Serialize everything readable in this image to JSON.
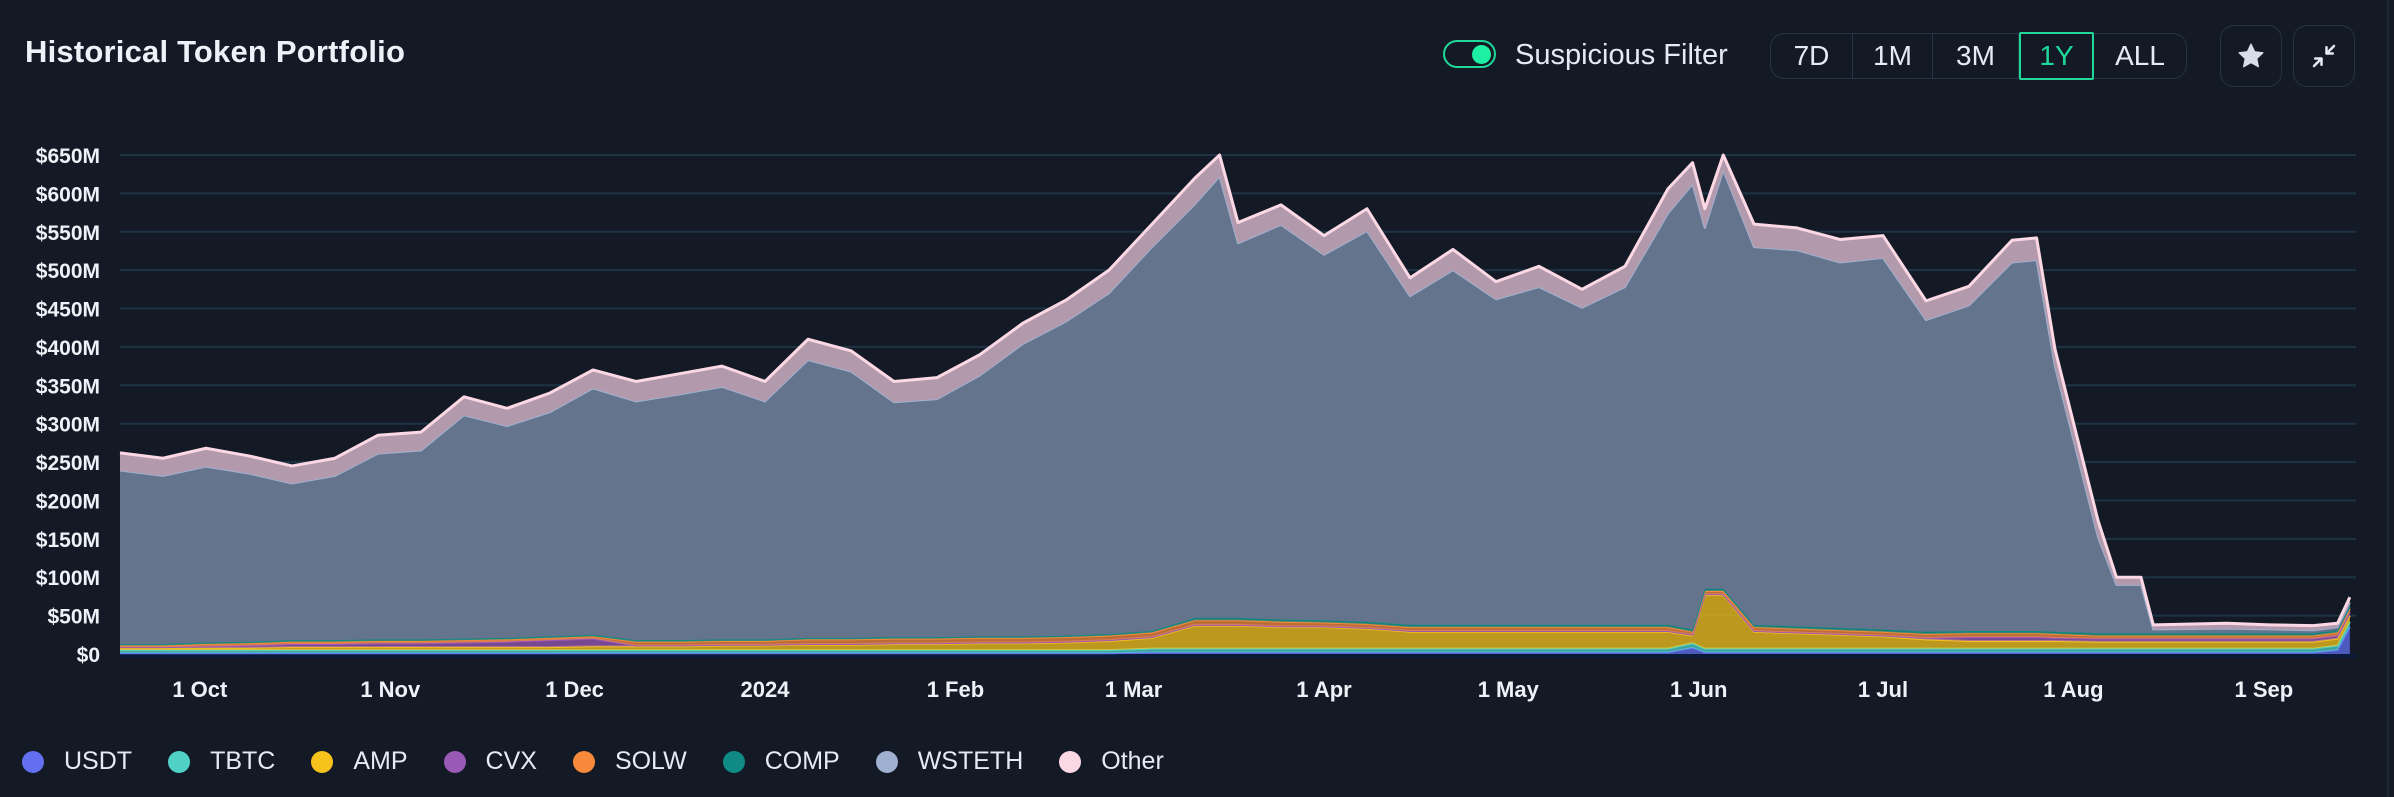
{
  "header": {
    "title": "Historical Token Portfolio",
    "suspicious_filter": {
      "label": "Suspicious Filter",
      "enabled": true
    },
    "ranges": [
      {
        "label": "7D",
        "active": false
      },
      {
        "label": "1M",
        "active": false
      },
      {
        "label": "3M",
        "active": false
      },
      {
        "label": "1Y",
        "active": true
      },
      {
        "label": "ALL",
        "active": false
      }
    ],
    "favorite_icon": "star-icon",
    "collapse_icon": "collapse-arrows-icon"
  },
  "colors": {
    "background": "#131a25",
    "accent": "#1fd99a",
    "gridline": "#1e3344"
  },
  "chart_data": {
    "type": "area",
    "stacked": true,
    "title": "Historical Token Portfolio",
    "xlabel": "",
    "ylabel": "",
    "ylim": [
      0,
      650
    ],
    "y_unit": "$M",
    "grid": true,
    "legend_position": "bottom-left",
    "yticks": [
      "$0",
      "$50M",
      "$100M",
      "$150M",
      "$200M",
      "$250M",
      "$300M",
      "$350M",
      "$400M",
      "$450M",
      "$500M",
      "$550M",
      "$600M",
      "$650M"
    ],
    "xticks": [
      {
        "label": "1 Oct",
        "date": "2023-10-01"
      },
      {
        "label": "1 Nov",
        "date": "2023-11-01"
      },
      {
        "label": "1 Dec",
        "date": "2023-12-01"
      },
      {
        "label": "2024",
        "date": "2024-01-01"
      },
      {
        "label": "1 Feb",
        "date": "2024-02-01"
      },
      {
        "label": "1 Mar",
        "date": "2024-03-01"
      },
      {
        "label": "1 Apr",
        "date": "2024-04-01"
      },
      {
        "label": "1 May",
        "date": "2024-05-01"
      },
      {
        "label": "1 Jun",
        "date": "2024-06-01"
      },
      {
        "label": "1 Jul",
        "date": "2024-07-01"
      },
      {
        "label": "1 Aug",
        "date": "2024-08-01"
      },
      {
        "label": "1 Sep",
        "date": "2024-09-01"
      }
    ],
    "x_range": [
      "2023-09-18",
      "2024-09-16"
    ],
    "x": [
      "2023-09-18",
      "2023-09-25",
      "2023-10-02",
      "2023-10-09",
      "2023-10-16",
      "2023-10-23",
      "2023-10-30",
      "2023-11-06",
      "2023-11-13",
      "2023-11-20",
      "2023-11-27",
      "2023-12-04",
      "2023-12-11",
      "2023-12-18",
      "2023-12-25",
      "2024-01-01",
      "2024-01-08",
      "2024-01-15",
      "2024-01-22",
      "2024-01-29",
      "2024-02-05",
      "2024-02-12",
      "2024-02-19",
      "2024-02-26",
      "2024-03-04",
      "2024-03-11",
      "2024-03-15",
      "2024-03-18",
      "2024-03-25",
      "2024-04-01",
      "2024-04-08",
      "2024-04-15",
      "2024-04-22",
      "2024-04-29",
      "2024-05-06",
      "2024-05-13",
      "2024-05-20",
      "2024-05-27",
      "2024-05-31",
      "2024-06-02",
      "2024-06-05",
      "2024-06-10",
      "2024-06-17",
      "2024-06-24",
      "2024-07-01",
      "2024-07-08",
      "2024-07-15",
      "2024-07-22",
      "2024-07-26",
      "2024-07-29",
      "2024-08-05",
      "2024-08-08",
      "2024-08-12",
      "2024-08-14",
      "2024-08-26",
      "2024-09-02",
      "2024-09-09",
      "2024-09-13",
      "2024-09-15"
    ],
    "series": [
      {
        "name": "USDT",
        "color": "#6270f0",
        "values": [
          1,
          1,
          1,
          1,
          1,
          1,
          1,
          1,
          1,
          1,
          1,
          1,
          1,
          1,
          1,
          1,
          1,
          1,
          1,
          1,
          1,
          1,
          1,
          1,
          2,
          2,
          2,
          2,
          2,
          2,
          2,
          2,
          2,
          2,
          2,
          2,
          2,
          2,
          8,
          2,
          2,
          2,
          2,
          2,
          2,
          2,
          2,
          2,
          2,
          2,
          2,
          2,
          2,
          2,
          2,
          2,
          2,
          5,
          35
        ]
      },
      {
        "name": "TBTC",
        "color": "#4fd1c5",
        "values": [
          4,
          4,
          4,
          4,
          4,
          4,
          4,
          4,
          4,
          4,
          4,
          4,
          4,
          4,
          4,
          4,
          4,
          4,
          4,
          4,
          4,
          4,
          4,
          4,
          5,
          5,
          5,
          5,
          5,
          5,
          5,
          5,
          5,
          5,
          5,
          5,
          5,
          5,
          6,
          5,
          5,
          5,
          5,
          5,
          5,
          5,
          5,
          5,
          5,
          5,
          5,
          5,
          5,
          5,
          5,
          5,
          5,
          6,
          7
        ]
      },
      {
        "name": "AMP",
        "color": "#f6c31c",
        "values": [
          3,
          3,
          3,
          3,
          4,
          4,
          4,
          4,
          4,
          4,
          4,
          5,
          5,
          5,
          6,
          6,
          7,
          7,
          8,
          8,
          9,
          9,
          10,
          12,
          14,
          30,
          30,
          30,
          28,
          28,
          26,
          22,
          22,
          22,
          22,
          22,
          22,
          22,
          10,
          70,
          70,
          22,
          20,
          18,
          16,
          12,
          10,
          10,
          10,
          10,
          9,
          9,
          9,
          9,
          9,
          9,
          9,
          9,
          8
        ]
      },
      {
        "name": "CVX",
        "color": "#9b59b6",
        "values": [
          1,
          1,
          2,
          3,
          4,
          4,
          5,
          5,
          6,
          7,
          9,
          10,
          1,
          1,
          1,
          1,
          1,
          1,
          1,
          1,
          1,
          1,
          1,
          1,
          1,
          1,
          1,
          1,
          1,
          1,
          1,
          1,
          1,
          1,
          1,
          1,
          1,
          1,
          1,
          1,
          1,
          1,
          1,
          1,
          1,
          2,
          5,
          5,
          5,
          4,
          4,
          4,
          4,
          4,
          4,
          4,
          4,
          4,
          5
        ]
      },
      {
        "name": "SOLW",
        "color": "#f6893b",
        "values": [
          2,
          2,
          3,
          3,
          3,
          3,
          3,
          3,
          3,
          3,
          3,
          3,
          5,
          5,
          5,
          5,
          6,
          6,
          6,
          6,
          6,
          6,
          6,
          6,
          6,
          6,
          6,
          6,
          6,
          5,
          5,
          5,
          5,
          5,
          5,
          5,
          5,
          5,
          4,
          4,
          4,
          5,
          5,
          5,
          5,
          5,
          5,
          5,
          5,
          5,
          4,
          4,
          4,
          4,
          4,
          4,
          4,
          4,
          4
        ]
      },
      {
        "name": "COMP",
        "color": "#0f8a84",
        "values": [
          2,
          2,
          2,
          2,
          2,
          2,
          2,
          2,
          2,
          2,
          2,
          2,
          2,
          2,
          2,
          2,
          2,
          2,
          2,
          2,
          2,
          2,
          2,
          2,
          2,
          3,
          3,
          3,
          3,
          3,
          3,
          3,
          3,
          3,
          3,
          3,
          3,
          3,
          3,
          3,
          3,
          3,
          3,
          3,
          3,
          3,
          3,
          3,
          3,
          3,
          3,
          3,
          3,
          3,
          3,
          3,
          3,
          3,
          3
        ]
      },
      {
        "name": "WSTETH",
        "color": "#9fb0d0",
        "values": [
          226,
          219,
          229,
          219,
          204,
          214,
          242,
          246,
          291,
          276,
          292,
          321,
          311,
          320,
          329,
          310,
          362,
          347,
          306,
          310,
          340,
          381,
          409,
          444,
          500,
          539,
          575,
          488,
          514,
          476,
          509,
          428,
          462,
          424,
          440,
          413,
          440,
          536,
          580,
          470,
          545,
          492,
          490,
          476,
          484,
          406,
          424,
          480,
          483,
          345,
          125,
          63,
          63,
          5,
          6,
          5,
          4,
          4,
          5
        ]
      },
      {
        "name": "Other",
        "color": "#fbd8e4",
        "values": [
          23,
          23,
          24,
          23,
          23,
          23,
          24,
          24,
          24,
          23,
          25,
          24,
          26,
          27,
          27,
          26,
          27,
          27,
          27,
          28,
          27,
          27,
          28,
          30,
          30,
          34,
          28,
          27,
          26,
          25,
          29,
          24,
          27,
          23,
          27,
          24,
          27,
          32,
          28,
          25,
          20,
          30,
          29,
          30,
          29,
          25,
          25,
          29,
          29,
          23,
          22,
          10,
          10,
          6,
          7,
          6,
          6,
          5,
          7
        ]
      }
    ]
  },
  "legend": [
    {
      "label": "USDT",
      "color": "#6270f0"
    },
    {
      "label": "TBTC",
      "color": "#4fd1c5"
    },
    {
      "label": "AMP",
      "color": "#f6c31c"
    },
    {
      "label": "CVX",
      "color": "#9b59b6"
    },
    {
      "label": "SOLW",
      "color": "#f6893b"
    },
    {
      "label": "COMP",
      "color": "#0f8a84"
    },
    {
      "label": "WSTETH",
      "color": "#9fb0d0"
    },
    {
      "label": "Other",
      "color": "#fbd8e4"
    }
  ]
}
